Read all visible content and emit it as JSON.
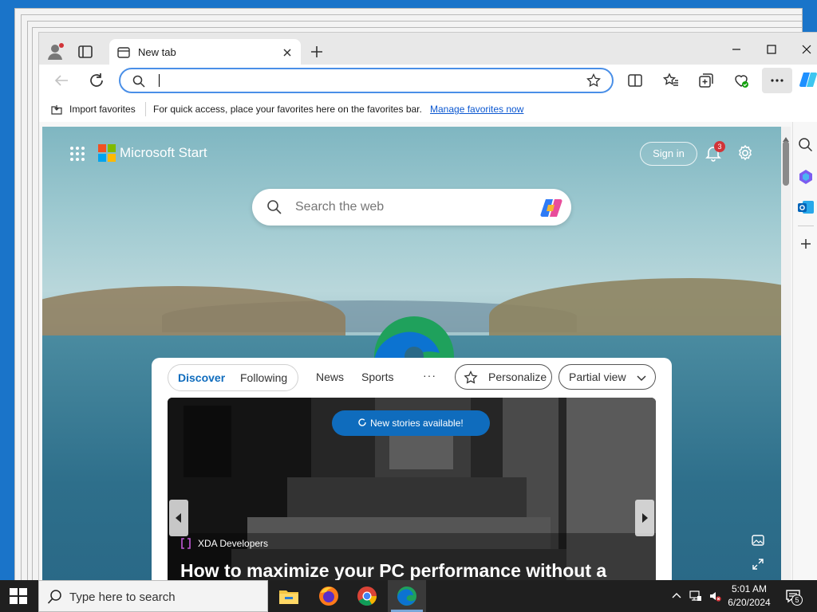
{
  "browser": {
    "tab": {
      "title": "New tab"
    },
    "address_bar": {
      "value": "",
      "placeholder": ""
    },
    "favorites_bar": {
      "import_label": "Import favorites",
      "message": "For quick access, place your favorites here on the favorites bar.",
      "link": "Manage favorites now"
    }
  },
  "page": {
    "brand": "Microsoft Start",
    "sign_in": "Sign in",
    "notification_count": "3",
    "search": {
      "placeholder": "Search the web"
    },
    "feed": {
      "tabs": {
        "discover": "Discover",
        "following": "Following"
      },
      "nav": {
        "news": "News",
        "sports": "Sports",
        "more": "···"
      },
      "personalize": "Personalize",
      "view_mode": "Partial view",
      "new_stories": "New stories available!",
      "story": {
        "source": "XDA Developers",
        "headline": "How to maximize your PC performance without a"
      }
    }
  },
  "taskbar": {
    "search_placeholder": "Type here to search",
    "clock": {
      "time": "5:01 AM",
      "date": "6/20/2024"
    },
    "notification_count": "5"
  },
  "colors": {
    "accent": "#0f6cbd",
    "desktop": "#1a74c9",
    "taskbar": "#1f1f1f",
    "badge": "#d13438"
  },
  "icons": {
    "browser": [
      "profile-icon",
      "tab-actions-icon",
      "new-tab-favicon",
      "close-icon",
      "plus-icon",
      "minimize-icon",
      "maximize-icon",
      "back-icon",
      "refresh-icon",
      "search-icon",
      "star-icon",
      "split-screen-icon",
      "favorites-icon",
      "collections-icon",
      "browser-essentials-icon",
      "more-icon",
      "copilot-icon"
    ],
    "page": [
      "app-launcher-icon",
      "microsoft-logo-icon",
      "bell-icon",
      "settings-icon",
      "edge-logo-icon",
      "personalize-icon",
      "chevron-down-icon"
    ],
    "taskbar": [
      "windows-start-icon",
      "file-explorer-icon",
      "firefox-icon",
      "chrome-icon",
      "edge-icon",
      "chevron-up-icon",
      "network-icon",
      "volume-muted-icon",
      "notification-icon"
    ]
  }
}
